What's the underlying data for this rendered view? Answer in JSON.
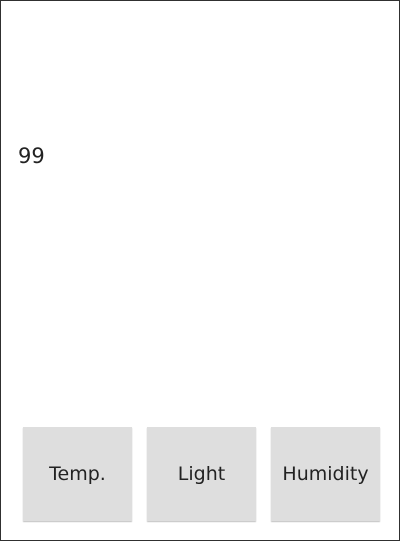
{
  "sensor_display": {
    "value": "99"
  },
  "buttons": {
    "temp_label": "Temp.",
    "light_label": "Light",
    "humidity_label": "Humidity"
  }
}
